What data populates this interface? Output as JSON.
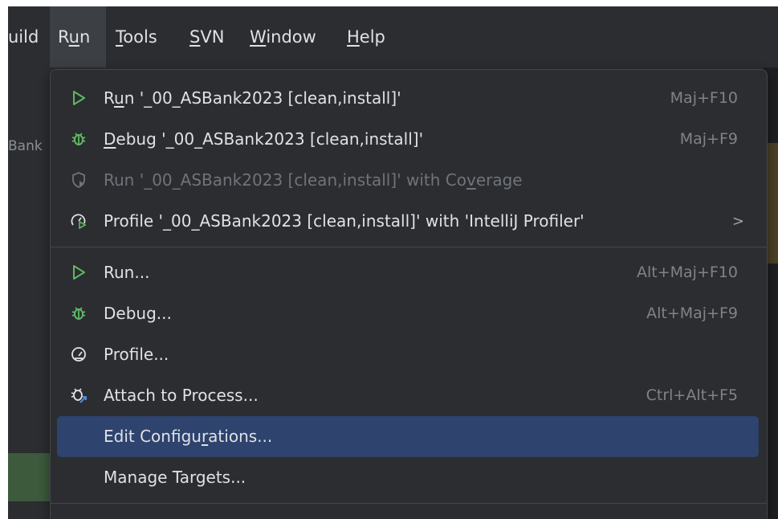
{
  "menubar": {
    "items": [
      {
        "label": "uild"
      },
      {
        "pre": "R",
        "ul": "u",
        "post": "n"
      },
      {
        "pre": "",
        "ul": "T",
        "post": "ools"
      },
      {
        "pre": "",
        "ul": "S",
        "post": "VN"
      },
      {
        "pre": "",
        "ul": "W",
        "post": "indow"
      },
      {
        "pre": "",
        "ul": "H",
        "post": "elp"
      }
    ]
  },
  "background": {
    "left_text": "Bank"
  },
  "run_menu": {
    "items": [
      {
        "icon": "play-icon",
        "pre": "R",
        "ul": "u",
        "post": "n '_00_ASBank2023 [clean,install]'",
        "shortcut": "Maj+F10"
      },
      {
        "icon": "bug-icon",
        "pre": "",
        "ul": "D",
        "post": "ebug '_00_ASBank2023 [clean,install]'",
        "shortcut": "Maj+F9"
      },
      {
        "icon": "shield-icon",
        "pre": "Run '_00_ASBank2023 [clean,install]' with Co",
        "ul": "v",
        "post": "erage",
        "shortcut": ""
      },
      {
        "icon": "profiler-icon",
        "pre": "Profile '_00_ASBank2023 [clean,install]' with 'IntelliJ Profiler'",
        "ul": "",
        "post": "",
        "shortcut": "",
        "submenu_arrow": ">"
      },
      {
        "icon": "play-icon",
        "pre": "Run...",
        "ul": "",
        "post": "",
        "shortcut": "Alt+Maj+F10"
      },
      {
        "icon": "bug-icon",
        "pre": "Debug...",
        "ul": "",
        "post": "",
        "shortcut": "Alt+Maj+F9"
      },
      {
        "icon": "gauge-icon",
        "pre": "Profile...",
        "ul": "",
        "post": "",
        "shortcut": ""
      },
      {
        "icon": "attach-bug-icon",
        "pre": "Attach to Process...",
        "ul": "",
        "post": "",
        "shortcut": "Ctrl+Alt+F5"
      },
      {
        "icon": "",
        "pre": "Edit Configu",
        "ul": "r",
        "post": "ations...",
        "shortcut": ""
      },
      {
        "icon": "",
        "pre": "Manage Targets...",
        "ul": "",
        "post": "",
        "shortcut": ""
      }
    ]
  },
  "colors": {
    "background": "#2b2d30",
    "selection": "#2e436e",
    "play_green": "#5fb865",
    "bug_green": "#5fb865",
    "text": "#dfe1e5",
    "shortcut": "#7f8389",
    "disabled": "#6f737a"
  }
}
